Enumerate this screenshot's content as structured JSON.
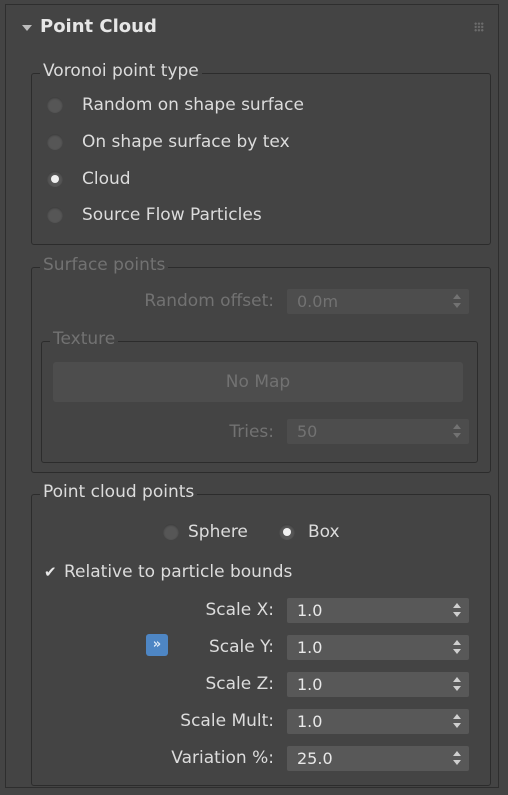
{
  "rollout": {
    "title": "Point Cloud"
  },
  "voronoi": {
    "title": "Voronoi point type",
    "options": [
      {
        "label": "Random on shape surface",
        "selected": false
      },
      {
        "label": "On shape surface by tex",
        "selected": false
      },
      {
        "label": "Cloud",
        "selected": true
      },
      {
        "label": "Source Flow Particles",
        "selected": false
      }
    ]
  },
  "surface": {
    "title": "Surface points",
    "random_offset_label": "Random offset:",
    "random_offset_value": "0.0m",
    "texture": {
      "title": "Texture",
      "map_button": "No Map",
      "tries_label": "Tries:",
      "tries_value": "50"
    }
  },
  "cloud": {
    "title": "Point cloud points",
    "shape_options": [
      {
        "label": "Sphere",
        "selected": false
      },
      {
        "label": "Box",
        "selected": true
      }
    ],
    "relative_label": "Relative to particle bounds",
    "relative_checked": true,
    "lock_icon": "double-chevron-right-icon",
    "fields": [
      {
        "label": "Scale X:",
        "value": "1.0"
      },
      {
        "label": "Scale Y:",
        "value": "1.0"
      },
      {
        "label": "Scale Z:",
        "value": "1.0"
      },
      {
        "label": "Scale Mult:",
        "value": "1.0"
      },
      {
        "label": "Variation %:",
        "value": "25.0"
      }
    ]
  }
}
